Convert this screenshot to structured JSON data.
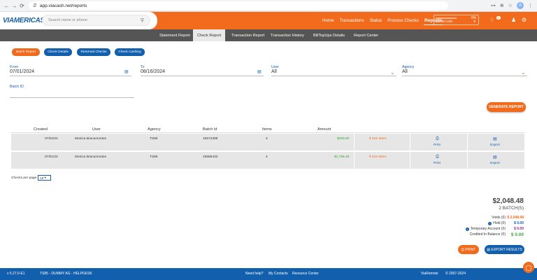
{
  "browser": {
    "url": "app.viacash.net/reports",
    "nav": [
      "←",
      "→",
      "⟳",
      "⇵"
    ],
    "right_icons": [
      "⊶",
      "⊕",
      "☆",
      "⋮"
    ],
    "profile_initial": "A"
  },
  "header": {
    "logo": "VIAMERICAS",
    "search_placeholder": "Search name or phone",
    "nav": [
      "Home",
      "Transactions",
      "Status",
      "Process Checks",
      "Reports"
    ],
    "active_nav": "Reports",
    "balance_percent": "0%",
    "balance_fill": 0,
    "balance_amount": "$10.00 USD",
    "bell_count": "0"
  },
  "subnav": {
    "tabs": [
      "Statement Report",
      "Check Report",
      "Transaction Report",
      "Transaction History",
      "BillTopUps Details",
      "Report Center"
    ],
    "active": "Check Report"
  },
  "report_buttons": [
    "Batch Report",
    "Check Details",
    "Returned Checks",
    "Check Cashing"
  ],
  "filters": {
    "from_label": "From",
    "from_value": "07/01/2024",
    "to_label": "To",
    "to_value": "08/16/2024",
    "user_label": "User",
    "user_value": "All",
    "agency_label": "Agency",
    "agency_value": "All",
    "batch_label": "Batch ID",
    "batch_value": ""
  },
  "generate_label": "GENERATE REPORT",
  "table": {
    "headers": [
      "Created",
      "User",
      "Agency",
      "Batch Id",
      "Items",
      "Amount"
    ],
    "rows": [
      {
        "created": "07/02/24",
        "user": "Monica Bracamontes",
        "agency": "TS85",
        "batch": "15572398",
        "items": "4",
        "amount": "$259.80",
        "see": "See More",
        "print": "Print",
        "export": "Export"
      },
      {
        "created": "07/01/24",
        "user": "Monica Bracamontes",
        "agency": "TS85",
        "batch": "15585433",
        "items": "4",
        "amount": "$1,788.48",
        "see": "See More",
        "print": "Print",
        "export": "Export"
      }
    ]
  },
  "per_page": {
    "label": "Checks per page",
    "value": "10"
  },
  "summary": {
    "total": "$2,048.48",
    "batches": "2 BATCH(S)",
    "rows": [
      {
        "label": "Voids (0)",
        "value": "$ 2,048.48",
        "color": "#f26b1d",
        "info": false
      },
      {
        "label": "Hold (0)",
        "value": "$ 0.00",
        "color": "#1760a8",
        "info": true
      },
      {
        "label": "Temporary Account (0)",
        "value": "$ 0.00",
        "color": "#8a2a8a",
        "info": true
      },
      {
        "label": "Credited In Balance (0)",
        "value": "$ 0.00",
        "color": "#3aa63a",
        "info": false
      }
    ]
  },
  "print_label": "PRINT",
  "export_results_label": "EXPORT RESULTS",
  "footer": {
    "version": "v 5.27.0-E1",
    "agency": "TS85 - DUMMY AG - HELPDESK",
    "help": "Need help?",
    "contacts": "My Contacts",
    "resource": "Resource Center",
    "brand": "ViaRemote",
    "copyright": "© 2007-2024"
  }
}
